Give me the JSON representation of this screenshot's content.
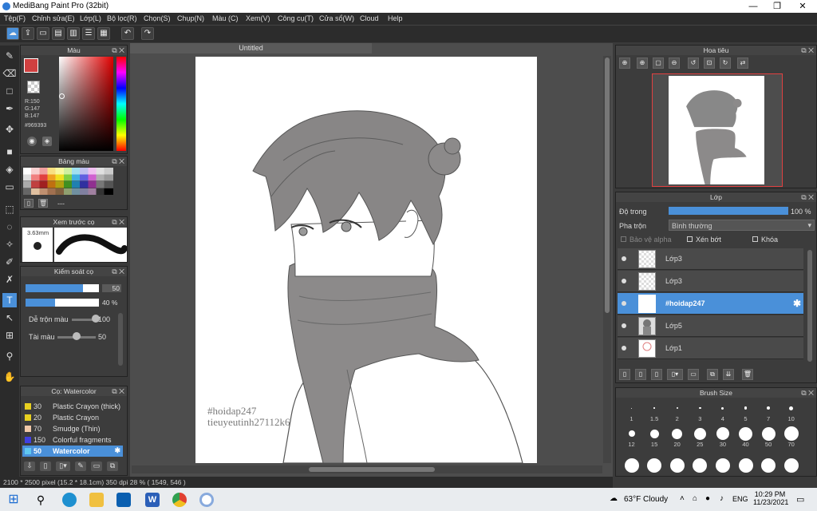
{
  "app": {
    "title": "MediBang Paint Pro (32bit)"
  },
  "menu": [
    "Tệp(F)",
    "Chỉnh sửa(E)",
    "Lớp(L)",
    "Bộ lọc(R)",
    "Chọn(S)",
    "Chụp(N)",
    "Màu (C)",
    "Xem(V)",
    "Công cụ(T)",
    "Cửa sổ(W)",
    "Cloud",
    "Help"
  ],
  "color_panel": {
    "title": "Màu",
    "r": "R:150",
    "g": "G:147",
    "b": "B:147",
    "hex": "#969393",
    "fg": "#969393"
  },
  "palette_panel": {
    "title": "Bảng màu",
    "dash": "---"
  },
  "brush_preview": {
    "title": "Xem trước cọ",
    "size": "3.63mm"
  },
  "brush_control": {
    "title": "Kiểm soát cọ",
    "size_val": "50",
    "opacity_val": "40 %",
    "mix_label": "Dễ trộn màu",
    "mix_val": "100",
    "amount_label": "Tài màu",
    "amount_val": "50",
    "size_level": 0.78,
    "opacity_level": 0.4,
    "mix_level": 1.0,
    "amount_level": 0.5
  },
  "brush_list": {
    "title": "Cọ: Watercolor",
    "items": [
      {
        "n": "30",
        "label": "Plastic Crayon (thick)",
        "color": "#e8d020"
      },
      {
        "n": "20",
        "label": "Plastic Crayon",
        "color": "#e8d020"
      },
      {
        "n": "70",
        "label": "Smudge (Thin)",
        "color": "#f0c8a8"
      },
      {
        "n": "150",
        "label": "Colorful fragments",
        "color": "#4040e0"
      },
      {
        "n": "50",
        "label": "Watercolor",
        "color": "#60c8f0"
      }
    ]
  },
  "document": {
    "tab": "Untitled",
    "watermark1": "#hoidap247",
    "watermark2": "tieuyeutinh27112k6"
  },
  "status": {
    "info": "2100 * 2500 pixel  (15.2 * 18.1cm)  350 dpi  28 %  ( 1549, 546 )"
  },
  "navigator": {
    "title": "Hoa tiêu"
  },
  "layers": {
    "title": "Lớp",
    "opacity_label": "Độ trong",
    "opacity_val": "100 %",
    "opacity_level": 1.0,
    "blend_label": "Pha trộn",
    "blend_val": "Bình thường",
    "protect_alpha": "Bảo vệ alpha",
    "clip": "Xén bớt",
    "lock": "Khóa",
    "items": [
      {
        "name": "Lớp3"
      },
      {
        "name": "Lớp3"
      },
      {
        "name": "#hoidap247"
      },
      {
        "name": "Lớp5"
      },
      {
        "name": "Lớp1"
      }
    ]
  },
  "brush_size": {
    "title": "Brush Size",
    "row1": [
      "1",
      "1.5",
      "2",
      "3",
      "4",
      "5",
      "7",
      "10"
    ],
    "row2": [
      "12",
      "15",
      "20",
      "25",
      "30",
      "40",
      "50",
      "70"
    ]
  },
  "taskbar": {
    "weather": "63°F  Cloudy",
    "lang": "ENG",
    "time": "10:29 PM",
    "date": "11/23/2021"
  }
}
